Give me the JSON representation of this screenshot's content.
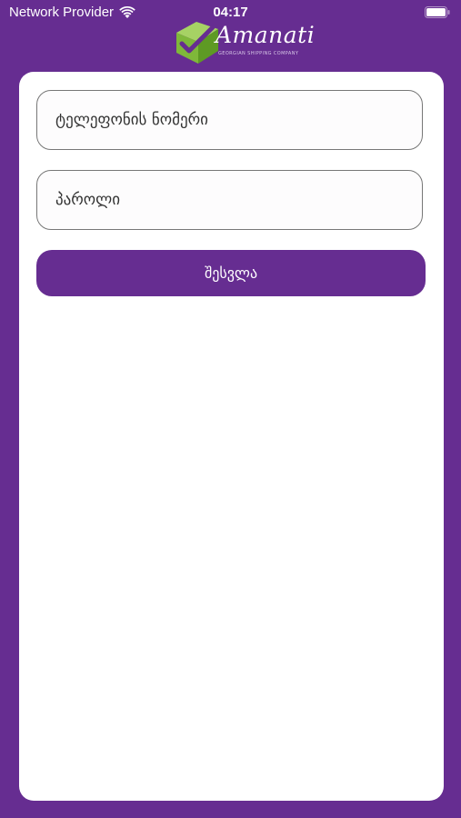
{
  "status_bar": {
    "carrier": "Network Provider",
    "time": "04:17"
  },
  "logo": {
    "name": "Amanati",
    "tagline": "GEORGIAN SHIPPING COMPANY"
  },
  "form": {
    "phone_placeholder": "ტელეფონის ნომერი",
    "password_placeholder": "პაროლი",
    "login_label": "შესვლა"
  },
  "colors": {
    "brand": "#662d91",
    "logo_green": "#8dc63f"
  }
}
